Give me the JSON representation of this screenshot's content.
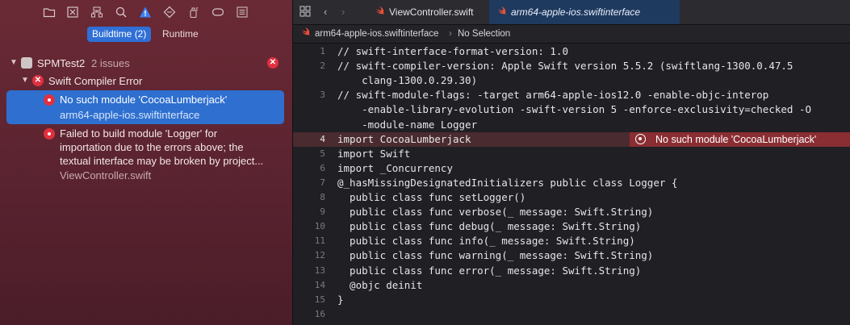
{
  "navigator": {
    "toolbar_icons": [
      "folder-icon",
      "x-square-icon",
      "hierarchy-icon",
      "search-icon",
      "warning-triangle-icon",
      "diamond-icon",
      "spray-icon",
      "tag-icon",
      "list-icon"
    ],
    "scope": {
      "buildtime": "Buildtime (2)",
      "runtime": "Runtime"
    },
    "project": {
      "name": "SPMTest2",
      "issues": "2 issues"
    },
    "group": {
      "label": "Swift Compiler Error"
    },
    "issues": [
      {
        "title": "No such module 'CocoaLumberjack'",
        "subtitle": "arm64-apple-ios.swiftinterface"
      },
      {
        "title_lines": [
          "Failed to build module 'Logger' for",
          "importation due to the errors above; the",
          "textual interface may be broken by project..."
        ],
        "subtitle": "ViewController.swift"
      }
    ]
  },
  "editor": {
    "tabs": [
      {
        "label": "ViewController.swift"
      },
      {
        "label": "arm64-apple-ios.swiftinterface"
      }
    ],
    "jumpbar": {
      "file": "arm64-apple-ios.swiftinterface",
      "selection": "No Selection"
    },
    "line_numbers": [
      "1",
      "2",
      "",
      "3",
      "",
      "",
      "4",
      "5",
      "6",
      "7",
      "8",
      "9",
      "10",
      "11",
      "12",
      "13",
      "14",
      "15",
      "16"
    ],
    "code_lines": [
      "// swift-interface-format-version: 1.0",
      "// swift-compiler-version: Apple Swift version 5.5.2 (swiftlang-1300.0.47.5",
      "    clang-1300.0.29.30)",
      "// swift-module-flags: -target arm64-apple-ios12.0 -enable-objc-interop",
      "    -enable-library-evolution -swift-version 5 -enforce-exclusivity=checked -O",
      "    -module-name Logger",
      "import CocoaLumberjack",
      "import Swift",
      "import _Concurrency",
      "@_hasMissingDesignatedInitializers public class Logger {",
      "  public class func setLogger()",
      "  public class func verbose(_ message: Swift.String)",
      "  public class func debug(_ message: Swift.String)",
      "  public class func info(_ message: Swift.String)",
      "  public class func warning(_ message: Swift.String)",
      "  public class func error(_ message: Swift.String)",
      "  @objc deinit",
      "}",
      ""
    ],
    "inline_error": "No such module 'CocoaLumberjack'"
  }
}
